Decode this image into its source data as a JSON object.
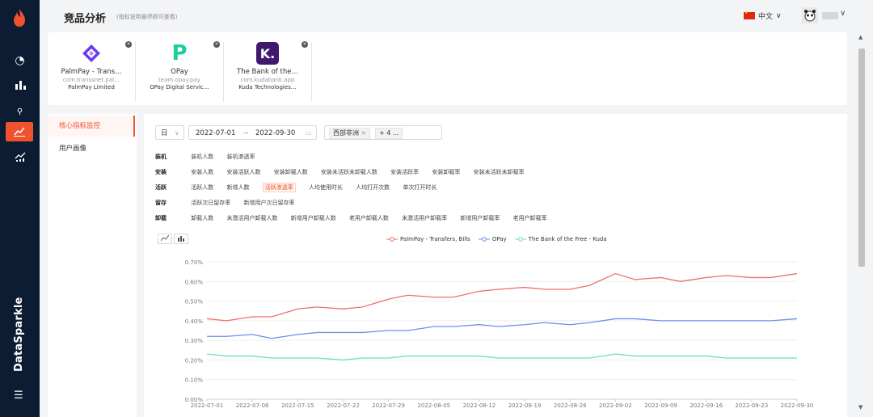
{
  "header": {
    "title": "竞品分析",
    "subtitle": "(指标说明悬停即可查看)",
    "language": "中文",
    "brand": "DataSparkle"
  },
  "apps": [
    {
      "name": "PalmPay - Trans…",
      "package": "com.transsnet.pal…",
      "company": "PalmPay Limited",
      "logo_color": "#6a3cf0"
    },
    {
      "name": "OPay",
      "package": "team.opay.pay",
      "company": "OPay Digital Servic…",
      "logo_color": "#1dcf9f"
    },
    {
      "name": "The Bank of the…",
      "package": "com.kudabank.app",
      "company": "Kuda Technologies…",
      "logo_color": "#40196d"
    }
  ],
  "left_menu": [
    {
      "label": "核心指标监控"
    },
    {
      "label": "用户画像"
    }
  ],
  "filters": {
    "granularity": "日",
    "start_date": "2022-07-01",
    "end_date": "2022-09-30",
    "region": "西部非洲",
    "more": "+ 4 ..."
  },
  "metric_groups": [
    {
      "category": "装机",
      "items": [
        "装机人数",
        "装机渗透率"
      ]
    },
    {
      "category": "安装",
      "items": [
        "安装人数",
        "安装活跃人数",
        "安装卸载人数",
        "安装未活跃未卸载人数",
        "安装活跃率",
        "安装卸载率",
        "安装未活跃未卸载率"
      ]
    },
    {
      "category": "活跃",
      "items": [
        "活跃人数",
        "新增人数",
        "活跃渗透率",
        "人均使用时长",
        "人均打开次数",
        "单次打开时长"
      ]
    },
    {
      "category": "留存",
      "items": [
        "活跃次日留存率",
        "新增用户次日留存率"
      ]
    },
    {
      "category": "卸载",
      "items": [
        "卸载人数",
        "未激活用户卸载人数",
        "新增用户卸载人数",
        "老用户卸载人数",
        "未激活用户卸载率",
        "新增用户卸载率",
        "老用户卸载率"
      ]
    }
  ],
  "selected_metric": "活跃渗透率",
  "chart_data": {
    "type": "line",
    "x": [
      "2022-07-01",
      "2022-07-04",
      "2022-07-08",
      "2022-07-11",
      "2022-07-15",
      "2022-07-18",
      "2022-07-22",
      "2022-07-25",
      "2022-07-29",
      "2022-08-01",
      "2022-08-05",
      "2022-08-08",
      "2022-08-12",
      "2022-08-15",
      "2022-08-19",
      "2022-08-22",
      "2022-08-26",
      "2022-08-29",
      "2022-09-02",
      "2022-09-05",
      "2022-09-09",
      "2022-09-12",
      "2022-09-16",
      "2022-09-19",
      "2022-09-23",
      "2022-09-26",
      "2022-09-30"
    ],
    "x_ticks": [
      "2022-07-01",
      "2022-07-08",
      "2022-07-15",
      "2022-07-22",
      "2022-07-29",
      "2022-08-05",
      "2022-08-12",
      "2022-08-19",
      "2022-08-26",
      "2022-09-02",
      "2022-09-09",
      "2022-09-16",
      "2022-09-23",
      "2022-09-30"
    ],
    "y_ticks": [
      "0.00%",
      "0.10%",
      "0.20%",
      "0.30%",
      "0.40%",
      "0.50%",
      "0.60%",
      "0.70%"
    ],
    "ylim": [
      0,
      0.7
    ],
    "series": [
      {
        "name": "PalmPay - Transfers, Bills",
        "color": "#ee6f6c",
        "values": [
          0.41,
          0.4,
          0.42,
          0.42,
          0.46,
          0.47,
          0.46,
          0.47,
          0.51,
          0.53,
          0.52,
          0.52,
          0.55,
          0.56,
          0.57,
          0.56,
          0.56,
          0.58,
          0.64,
          0.61,
          0.62,
          0.6,
          0.62,
          0.63,
          0.62,
          0.62,
          0.64
        ]
      },
      {
        "name": "OPay",
        "color": "#6b8fe8",
        "values": [
          0.32,
          0.32,
          0.33,
          0.31,
          0.33,
          0.34,
          0.34,
          0.34,
          0.35,
          0.35,
          0.37,
          0.37,
          0.38,
          0.37,
          0.38,
          0.39,
          0.38,
          0.39,
          0.41,
          0.41,
          0.4,
          0.4,
          0.4,
          0.4,
          0.4,
          0.4,
          0.41
        ]
      },
      {
        "name": "The Bank of the Free - Kuda",
        "color": "#6fdfb0",
        "values": [
          0.23,
          0.22,
          0.22,
          0.21,
          0.21,
          0.21,
          0.2,
          0.21,
          0.21,
          0.22,
          0.22,
          0.22,
          0.22,
          0.21,
          0.21,
          0.21,
          0.21,
          0.21,
          0.23,
          0.22,
          0.22,
          0.22,
          0.22,
          0.21,
          0.21,
          0.21,
          0.21
        ]
      }
    ]
  }
}
